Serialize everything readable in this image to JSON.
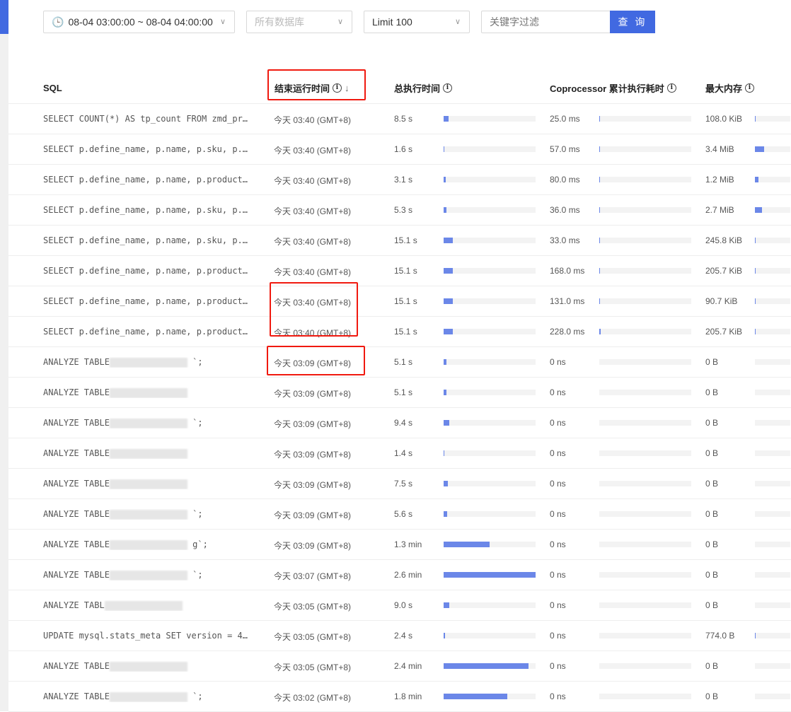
{
  "toolbar": {
    "time_range": "08-04 03:00:00 ~ 08-04 04:00:00",
    "database_placeholder": "所有数据库",
    "limit": "Limit 100",
    "keyword_placeholder": "关键字过滤",
    "query_button": "查 询"
  },
  "columns": {
    "sql": "SQL",
    "end_time": "结束运行时间",
    "total_time": "总执行时间",
    "coprocessor": "Coprocessor 累计执行耗时",
    "max_mem": "最大内存"
  },
  "colors": {
    "accent": "#4169e1",
    "bar": "#6b87e8",
    "annotation": "#f0190f",
    "keyword": "#b03cb8"
  },
  "rows": [
    {
      "sql_kw": "SELECT",
      "sql_rest": " COUNT(*) AS tp_count FROM zmd_pr…",
      "end": "今天 03:40 (GMT+8)",
      "total": "8.5 s",
      "total_frac": 0.055,
      "cop": "25.0 ms",
      "cop_frac": 0.01,
      "mem": "108.0 KiB",
      "mem_frac": 0.01
    },
    {
      "sql_kw": "SELECT",
      "sql_rest": " p.define_name, p.name, p.sku, p.…",
      "end": "今天 03:40 (GMT+8)",
      "total": "1.6 s",
      "total_frac": 0.01,
      "cop": "57.0 ms",
      "cop_frac": 0.01,
      "mem": "3.4 MiB",
      "mem_frac": 0.25
    },
    {
      "sql_kw": "SELECT",
      "sql_rest": " p.define_name, p.name, p.product…",
      "end": "今天 03:40 (GMT+8)",
      "total": "3.1 s",
      "total_frac": 0.02,
      "cop": "80.0 ms",
      "cop_frac": 0.01,
      "mem": "1.2 MiB",
      "mem_frac": 0.09
    },
    {
      "sql_kw": "SELECT",
      "sql_rest": " p.define_name, p.name, p.sku, p.…",
      "end": "今天 03:40 (GMT+8)",
      "total": "5.3 s",
      "total_frac": 0.03,
      "cop": "36.0 ms",
      "cop_frac": 0.01,
      "mem": "2.7 MiB",
      "mem_frac": 0.2
    },
    {
      "sql_kw": "SELECT",
      "sql_rest": " p.define_name, p.name, p.sku, p.…",
      "end": "今天 03:40 (GMT+8)",
      "total": "15.1 s",
      "total_frac": 0.097,
      "cop": "33.0 ms",
      "cop_frac": 0.01,
      "mem": "245.8 KiB",
      "mem_frac": 0.018
    },
    {
      "sql_kw": "SELECT",
      "sql_rest": " p.define_name, p.name, p.product…",
      "end": "今天 03:40 (GMT+8)",
      "total": "15.1 s",
      "total_frac": 0.097,
      "cop": "168.0 ms",
      "cop_frac": 0.01,
      "mem": "205.7 KiB",
      "mem_frac": 0.015
    },
    {
      "sql_kw": "SELECT",
      "sql_rest": " p.define_name, p.name, p.product…",
      "end": "今天 03:40 (GMT+8)",
      "total": "15.1 s",
      "total_frac": 0.097,
      "cop": "131.0 ms",
      "cop_frac": 0.01,
      "mem": "90.7 KiB",
      "mem_frac": 0.008
    },
    {
      "sql_kw": "SELECT",
      "sql_rest": " p.define_name, p.name, p.product…",
      "end": "今天 03:40 (GMT+8)",
      "total": "15.1 s",
      "total_frac": 0.097,
      "cop": "228.0 ms",
      "cop_frac": 0.015,
      "mem": "205.7 KiB",
      "mem_frac": 0.015
    },
    {
      "sql_pre": "ANALYZE ",
      "sql_kw": "TABLE",
      "sql_rest": " `;",
      "end": "今天 03:09 (GMT+8)",
      "total": "5.1 s",
      "total_frac": 0.033,
      "cop": "0 ns",
      "cop_frac": 0,
      "mem": "0 B",
      "mem_frac": 0
    },
    {
      "sql_pre": "ANALYZE ",
      "sql_kw": "TABLE",
      "sql_rest": "",
      "end": "今天 03:09 (GMT+8)",
      "total": "5.1 s",
      "total_frac": 0.033,
      "cop": "0 ns",
      "cop_frac": 0,
      "mem": "0 B",
      "mem_frac": 0
    },
    {
      "sql_pre": "ANALYZE ",
      "sql_kw": "TABLE",
      "sql_rest": " `;",
      "end": "今天 03:09 (GMT+8)",
      "total": "9.4 s",
      "total_frac": 0.06,
      "cop": "0 ns",
      "cop_frac": 0,
      "mem": "0 B",
      "mem_frac": 0
    },
    {
      "sql_pre": "ANALYZE ",
      "sql_kw": "TABLE",
      "sql_rest": "",
      "end": "今天 03:09 (GMT+8)",
      "total": "1.4 s",
      "total_frac": 0.009,
      "cop": "0 ns",
      "cop_frac": 0,
      "mem": "0 B",
      "mem_frac": 0
    },
    {
      "sql_pre": "ANALYZE ",
      "sql_kw": "TABLE",
      "sql_rest": "",
      "end": "今天 03:09 (GMT+8)",
      "total": "7.5 s",
      "total_frac": 0.048,
      "cop": "0 ns",
      "cop_frac": 0,
      "mem": "0 B",
      "mem_frac": 0
    },
    {
      "sql_pre": "ANALYZE ",
      "sql_kw": "TABLE",
      "sql_rest": " `;",
      "end": "今天 03:09 (GMT+8)",
      "total": "5.6 s",
      "total_frac": 0.036,
      "cop": "0 ns",
      "cop_frac": 0,
      "mem": "0 B",
      "mem_frac": 0
    },
    {
      "sql_pre": "ANALYZE ",
      "sql_kw": "TABLE",
      "sql_rest": " g`;",
      "end": "今天 03:09 (GMT+8)",
      "total": "1.3 min",
      "total_frac": 0.5,
      "cop": "0 ns",
      "cop_frac": 0,
      "mem": "0 B",
      "mem_frac": 0
    },
    {
      "sql_pre": "ANALYZE ",
      "sql_kw": "TABLE",
      "sql_rest": " `;",
      "end": "今天 03:07 (GMT+8)",
      "total": "2.6 min",
      "total_frac": 1.0,
      "cop": "0 ns",
      "cop_frac": 0,
      "mem": "0 B",
      "mem_frac": 0
    },
    {
      "sql_pre": "ANALYZE ",
      "sql_kw": "TABL",
      "sql_rest": "",
      "end": "今天 03:05 (GMT+8)",
      "total": "9.0 s",
      "total_frac": 0.058,
      "cop": "0 ns",
      "cop_frac": 0,
      "mem": "0 B",
      "mem_frac": 0
    },
    {
      "sql_pre": "UPDATE mysql.stats_meta ",
      "sql_kw": "SET",
      "sql_rest": " version = 4…",
      "end": "今天 03:05 (GMT+8)",
      "total": "2.4 s",
      "total_frac": 0.015,
      "cop": "0 ns",
      "cop_frac": 0,
      "mem": "774.0 B",
      "mem_frac": 0.001
    },
    {
      "sql_pre": "ANALYZE ",
      "sql_kw": "TABLE",
      "sql_rest": "",
      "end": "今天 03:05 (GMT+8)",
      "total": "2.4 min",
      "total_frac": 0.92,
      "cop": "0 ns",
      "cop_frac": 0,
      "mem": "0 B",
      "mem_frac": 0
    },
    {
      "sql_pre": "ANALYZE ",
      "sql_kw": "TABLE",
      "sql_rest": " `;",
      "end": "今天 03:02 (GMT+8)",
      "total": "1.8 min",
      "total_frac": 0.69,
      "cop": "0 ns",
      "cop_frac": 0,
      "mem": "0 B",
      "mem_frac": 0
    }
  ]
}
